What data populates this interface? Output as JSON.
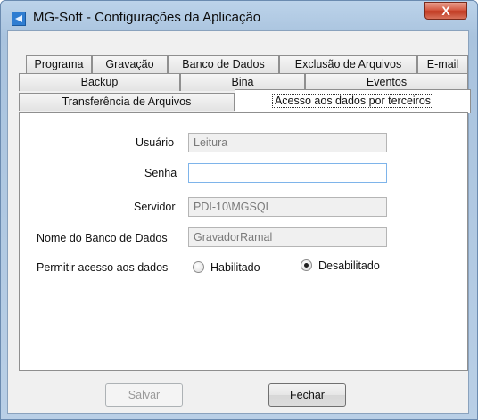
{
  "window": {
    "title": "MG-Soft - Configurações da Aplicação",
    "close_glyph": "X"
  },
  "tabs": {
    "row1": [
      "Programa",
      "Gravação",
      "Banco de Dados",
      "Exclusão de Arquivos",
      "E-mail"
    ],
    "row2": [
      "Backup",
      "Bina",
      "Eventos"
    ],
    "row3": [
      "Transferência de Arquivos",
      "Acesso aos dados por terceiros"
    ],
    "active": "Acesso aos dados por terceiros"
  },
  "form": {
    "usuario_label": "Usuário",
    "usuario_value": "Leitura",
    "senha_label": "Senha",
    "senha_value": "",
    "servidor_label": "Servidor",
    "servidor_value": "PDI-10\\MGSQL",
    "banco_label": "Nome do Banco de Dados",
    "banco_value": "GravadorRamal",
    "permitir_label": "Permitir acesso aos dados",
    "option_enabled": "Habilitado",
    "option_disabled": "Desabilitado",
    "selected_option": "Desabilitado"
  },
  "buttons": {
    "save": "Salvar",
    "close": "Fechar"
  },
  "colors": {
    "frame": "#b9cfe6",
    "close_button": "#c13a22",
    "focus_border": "#7eb4ea"
  },
  "icons": {
    "app": "app-icon",
    "close": "close-icon"
  }
}
